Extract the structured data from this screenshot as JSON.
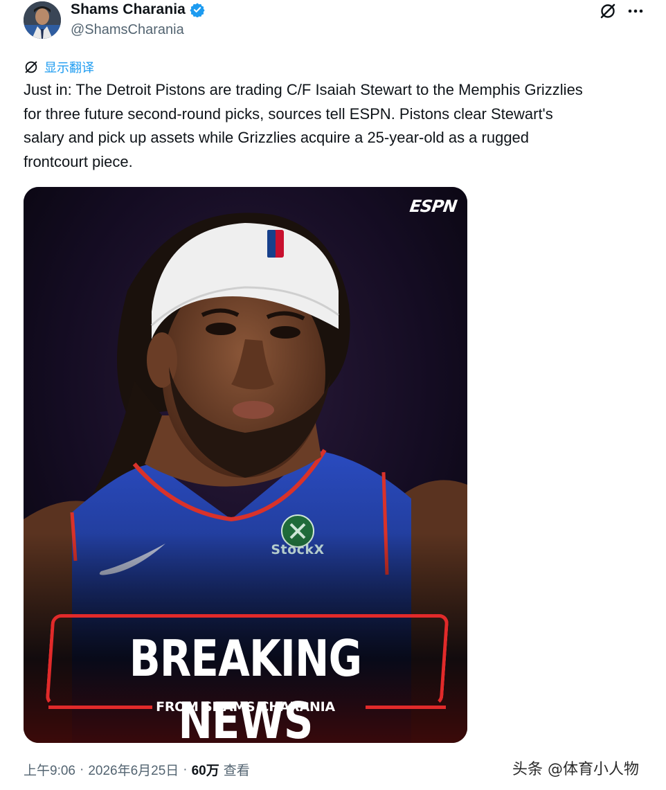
{
  "tweet": {
    "author": {
      "display_name": "Shams Charania",
      "handle": "@ShamsCharania",
      "verified": true,
      "verified_color": "#1d9bf0"
    },
    "actions": {
      "grok_icon": "grok-icon",
      "more_icon": "more-icon"
    },
    "translate_label": "显示翻译",
    "text": "Just in: The Detroit Pistons are trading C/F Isaiah Stewart to the Memphis Grizzlies\nfor three future second-round picks, sources tell ESPN. Pistons clear Stewart's\nsalary and pick up assets while Grizzlies acquire a 25-year-old as a rugged\nfrontcourt piece.",
    "media": {
      "brand_logo": "ESPN",
      "sponsor_patch": "StockX",
      "headline": "BREAKING NEWS",
      "subheadline": "FROM SHAMS CHARANIA",
      "accent_color": "#e12a2a",
      "jersey_color": "#1f3fa8"
    },
    "footer": {
      "time": "上午9:06",
      "separator": "·",
      "date": "2026年6月25日",
      "separator2": "·",
      "views_count": "60万",
      "views_label": "查看"
    }
  },
  "watermark": "头条 @体育小人物"
}
